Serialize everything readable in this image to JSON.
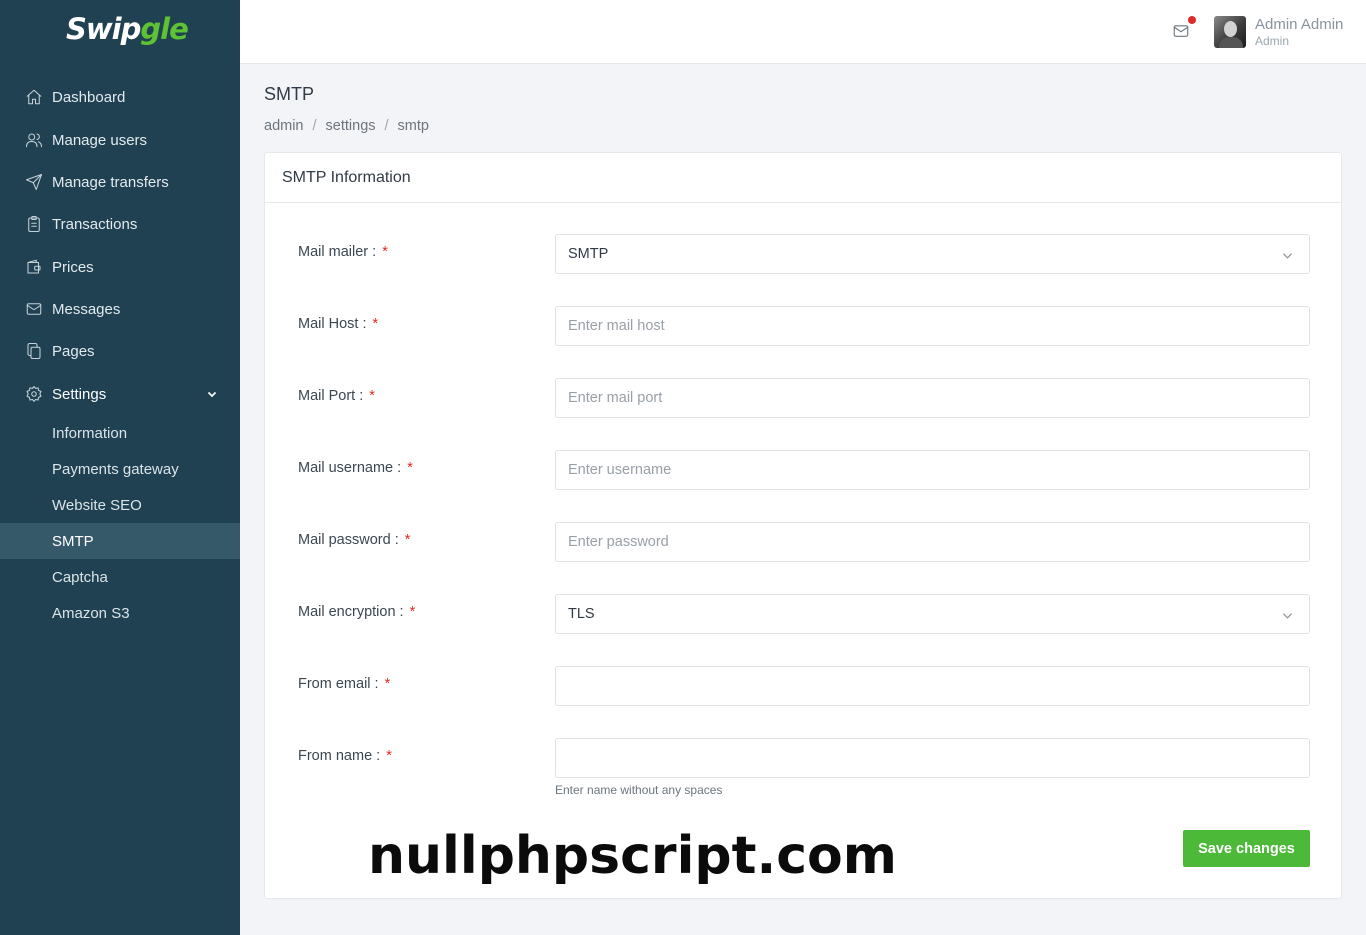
{
  "brand": {
    "part1": "Swip",
    "part2": "gle"
  },
  "sidebar": {
    "items": [
      {
        "label": "Dashboard",
        "icon": "home-icon"
      },
      {
        "label": "Manage users",
        "icon": "users-icon"
      },
      {
        "label": "Manage transfers",
        "icon": "send-icon"
      },
      {
        "label": "Transactions",
        "icon": "clipboard-icon"
      },
      {
        "label": "Prices",
        "icon": "wallet-icon"
      },
      {
        "label": "Messages",
        "icon": "mail-icon"
      },
      {
        "label": "Pages",
        "icon": "copy-icon"
      },
      {
        "label": "Settings",
        "icon": "gear-icon",
        "expanded": true
      }
    ],
    "settings_children": [
      {
        "label": "Information"
      },
      {
        "label": "Payments gateway"
      },
      {
        "label": "Website SEO"
      },
      {
        "label": "SMTP",
        "active": true
      },
      {
        "label": "Captcha"
      },
      {
        "label": "Amazon S3"
      }
    ]
  },
  "topbar": {
    "user_name": "Admin Admin",
    "user_role": "Admin",
    "has_notification": true
  },
  "page": {
    "title": "SMTP",
    "breadcrumb": [
      "admin",
      "settings",
      "smtp"
    ],
    "breadcrumb_separator": "/"
  },
  "card": {
    "title": "SMTP Information",
    "required_marker": "*",
    "fields": [
      {
        "label": "Mail mailer :",
        "type": "select",
        "value": "SMTP",
        "placeholder": ""
      },
      {
        "label": "Mail Host :",
        "type": "text",
        "value": "",
        "placeholder": "Enter mail host"
      },
      {
        "label": "Mail Port :",
        "type": "text",
        "value": "",
        "placeholder": "Enter mail port"
      },
      {
        "label": "Mail username :",
        "type": "text",
        "value": "",
        "placeholder": "Enter username"
      },
      {
        "label": "Mail password :",
        "type": "password",
        "value": "",
        "placeholder": "Enter password"
      },
      {
        "label": "Mail encryption :",
        "type": "select",
        "value": "TLS",
        "placeholder": ""
      },
      {
        "label": "From email :",
        "type": "text",
        "value": "",
        "placeholder": ""
      },
      {
        "label": "From name :",
        "type": "text",
        "value": "",
        "placeholder": ""
      }
    ],
    "from_name_help": "Enter name without any spaces",
    "save_label": "Save changes"
  },
  "watermark": "nullphpscript.com",
  "colors": {
    "sidebar_bg": "#1f4151",
    "sidebar_active_bg": "#36596a",
    "brand_green": "#5dc234",
    "save_button": "#4cb938",
    "required": "#e02b2b"
  }
}
